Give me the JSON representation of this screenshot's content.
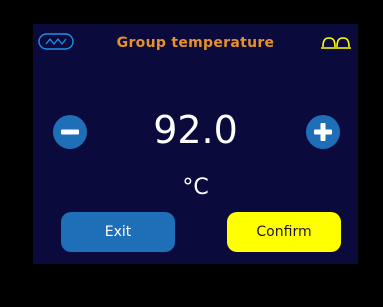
{
  "header": {
    "title": "Group temperature",
    "left_icon": "wave-icon",
    "right_icon": "coffee-cups-icon"
  },
  "stepper": {
    "value": "92.0",
    "unit": "°C",
    "decrease_icon": "minus-icon",
    "increase_icon": "plus-icon"
  },
  "actions": {
    "exit_label": "Exit",
    "confirm_label": "Confirm"
  },
  "colors": {
    "background": "#000000",
    "screen": "#0a0a3c",
    "title": "#e8902a",
    "accent_blue": "#1f6fb8",
    "confirm_yellow": "#ffff00",
    "text": "#ffffff"
  }
}
